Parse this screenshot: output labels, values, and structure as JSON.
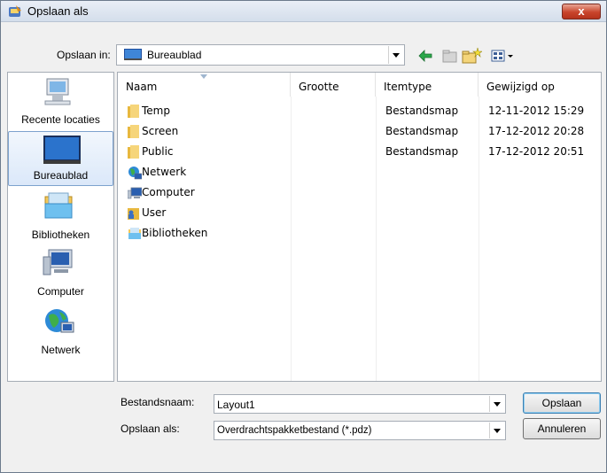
{
  "window": {
    "title": "Opslaan als",
    "close_label": "x"
  },
  "lookin": {
    "label": "Opslaan in:",
    "value": "Bureaublad"
  },
  "places": [
    {
      "label": "Recente locaties",
      "icon": "recent-locations-icon"
    },
    {
      "label": "Bureaublad",
      "icon": "desktop-icon"
    },
    {
      "label": "Bibliotheken",
      "icon": "libraries-icon"
    },
    {
      "label": "Computer",
      "icon": "computer-icon"
    },
    {
      "label": "Netwerk",
      "icon": "network-icon"
    }
  ],
  "columns": [
    "Naam",
    "Grootte",
    "Itemtype",
    "Gewijzigd op"
  ],
  "files": [
    {
      "name": "Temp",
      "size": "",
      "type": "Bestandsmap",
      "date": "12-11-2012 15:29",
      "icon": "folder-icon"
    },
    {
      "name": "Screen",
      "size": "",
      "type": "Bestandsmap",
      "date": "17-12-2012 20:28",
      "icon": "folder-icon"
    },
    {
      "name": "Public",
      "size": "",
      "type": "Bestandsmap",
      "date": "17-12-2012 20:51",
      "icon": "folder-icon"
    },
    {
      "name": "Netwerk",
      "size": "",
      "type": "",
      "date": "",
      "icon": "network-icon"
    },
    {
      "name": "Computer",
      "size": "",
      "type": "",
      "date": "",
      "icon": "computer-icon"
    },
    {
      "name": "User",
      "size": "",
      "type": "",
      "date": "",
      "icon": "user-folder-icon"
    },
    {
      "name": "Bibliotheken",
      "size": "",
      "type": "",
      "date": "",
      "icon": "libraries-icon"
    }
  ],
  "filename": {
    "label": "Bestandsnaam:",
    "value": "Layout1"
  },
  "filetype": {
    "label": "Opslaan als:",
    "value": "Overdrachtspakketbestand (*.pdz)"
  },
  "buttons": {
    "save": "Opslaan",
    "cancel": "Annuleren"
  },
  "colors": {
    "accent": "#3c7fb1",
    "folder": "#e8b83e",
    "close": "#c9452c"
  }
}
